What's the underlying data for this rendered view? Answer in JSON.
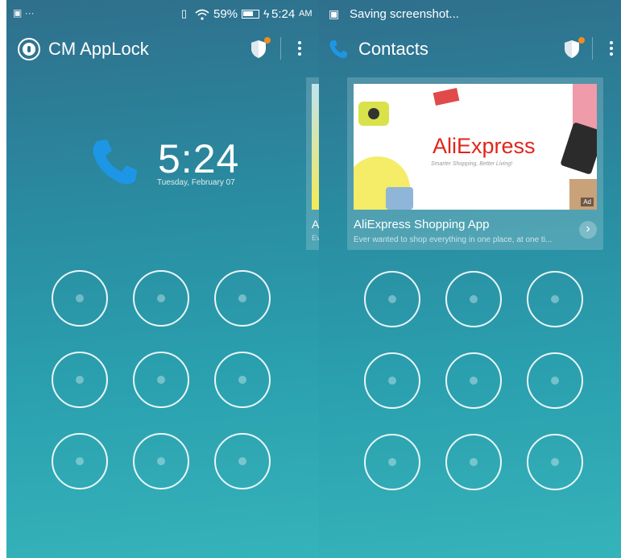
{
  "left": {
    "status": {
      "left_icons": "▣ ···",
      "battery_percent": "59%",
      "charge_symbol": "ϟ",
      "time": "5:24",
      "ampm": "AM"
    },
    "app_title": "CM AppLock",
    "clock": {
      "time": "5:24",
      "date": "Tuesday, February 07"
    },
    "peek_title": "A",
    "peek_sub": "Ev"
  },
  "right": {
    "status": {
      "left_icon": "▣",
      "message": "Saving screenshot..."
    },
    "app_title": "Contacts",
    "ad": {
      "brand": "AliExpress",
      "tagline": "Smarter Shopping, Better Living!",
      "badge": "Ad",
      "title": "AliExpress Shopping App",
      "description": "Ever wanted to shop everything in one place, at one ti...",
      "arrow": "›"
    }
  },
  "colors": {
    "accent_orange": "#f28c1e",
    "phone_blue": "#1e96e6",
    "aliexpress_red": "#e1251b"
  },
  "icons": [
    "applock-logo-icon",
    "shield-icon",
    "more-vert-icon",
    "phone-icon",
    "screenshot-icon",
    "wifi-icon",
    "vibrate-icon",
    "battery-icon",
    "chevron-right-icon"
  ]
}
